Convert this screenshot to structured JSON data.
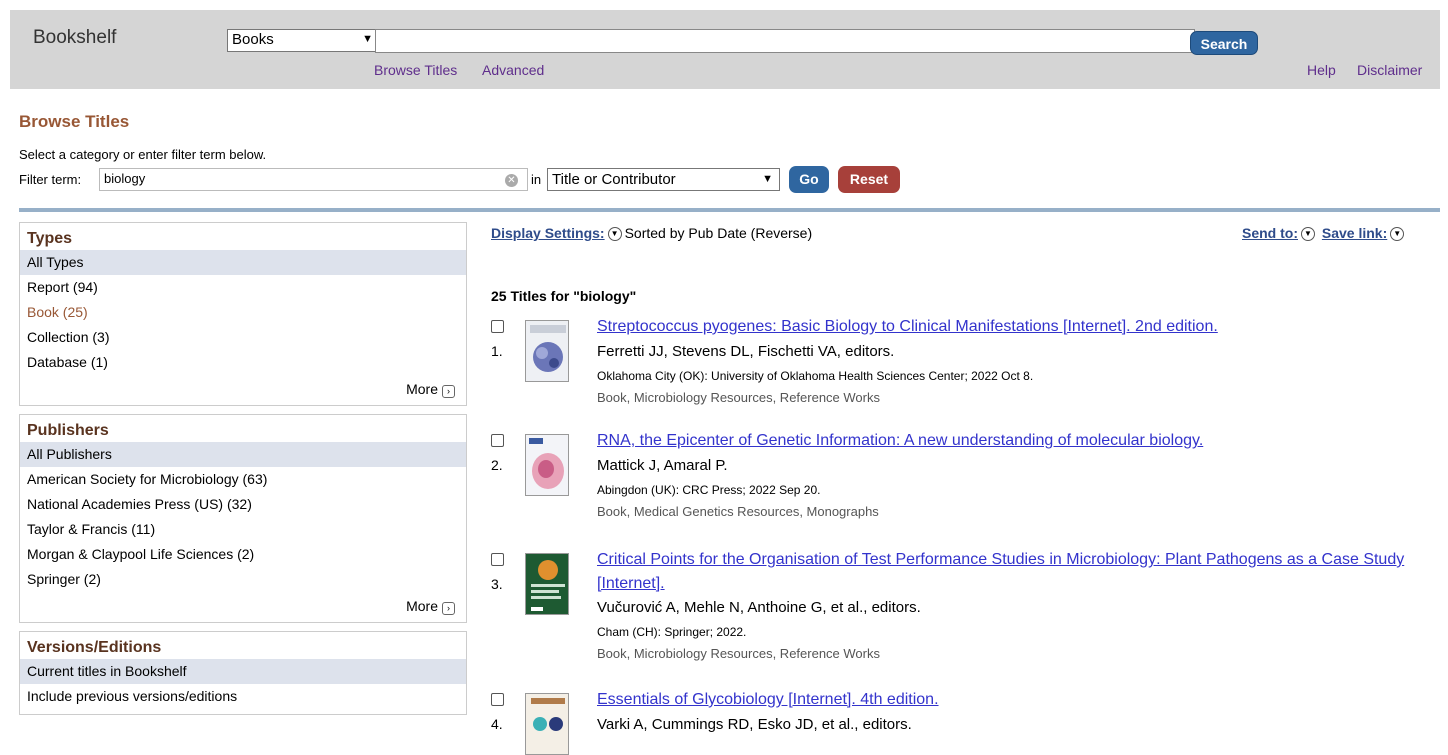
{
  "header": {
    "title": "Bookshelf",
    "db_select": "Books",
    "search_value": "",
    "search_button": "Search",
    "links": {
      "browse_titles": "Browse Titles",
      "advanced": "Advanced",
      "help": "Help",
      "disclaimer": "Disclaimer"
    }
  },
  "browse": {
    "title": "Browse Titles",
    "instructions": "Select a category or enter filter term below.",
    "filter_label": "Filter term:",
    "filter_value": "biology",
    "in_label": "in",
    "field_select": "Title or Contributor",
    "go_button": "Go",
    "reset_button": "Reset"
  },
  "facets": {
    "types": {
      "title": "Types",
      "items": [
        "All Types",
        "Report (94)",
        "Book (25)",
        "Collection (3)",
        "Database (1)"
      ],
      "more": "More"
    },
    "publishers": {
      "title": "Publishers",
      "items": [
        "All Publishers",
        "American Society for Microbiology (63)",
        "National Academies Press (US) (32)",
        "Taylor & Francis (11)",
        "Morgan & Claypool Life Sciences (2)",
        "Springer (2)"
      ],
      "more": "More"
    },
    "versions": {
      "title": "Versions/Editions",
      "items": [
        "Current titles in Bookshelf",
        "Include previous versions/editions"
      ]
    }
  },
  "results_bar": {
    "display_settings": "Display Settings:",
    "sort_text": "Sorted by Pub Date (Reverse)",
    "send_to": "Send to:",
    "save_link": "Save link:"
  },
  "results": {
    "count_heading": "25 Titles for \"biology\"",
    "items": [
      {
        "num": "1.",
        "title": "Streptococcus pyogenes: Basic Biology to Clinical Manifestations [Internet]. 2nd edition.",
        "authors": "Ferretti JJ, Stevens DL, Fischetti VA, editors.",
        "publisher": "Oklahoma City (OK): University of Oklahoma Health Sciences Center; 2022 Oct 8.",
        "tags": "Book, Microbiology Resources, Reference Works"
      },
      {
        "num": "2.",
        "title": "RNA, the Epicenter of Genetic Information: A new understanding of molecular biology.",
        "authors": "Mattick J, Amaral P.",
        "publisher": "Abingdon (UK): CRC Press; 2022 Sep 20.",
        "tags": "Book, Medical Genetics Resources, Monographs"
      },
      {
        "num": "3.",
        "title": "Critical Points for the Organisation of Test Performance Studies in Microbiology: Plant Pathogens as a Case Study [Internet].",
        "authors": "Vučurović A, Mehle N, Anthoine G, et al., editors.",
        "publisher": "Cham (CH): Springer; 2022.",
        "tags": "Book, Microbiology Resources, Reference Works"
      },
      {
        "num": "4.",
        "title": "Essentials of Glycobiology [Internet]. 4th edition.",
        "authors": "Varki A, Cummings RD, Esko JD, et al., editors.",
        "publisher": "",
        "tags": ""
      }
    ]
  },
  "colors": {
    "header_bg": "#d5d5d5",
    "title_brown": "#985735",
    "go_blue": "#2f66a0",
    "reset_red": "#a7403a",
    "link_blue": "#3333cc",
    "selected_bg": "#dde2ec"
  }
}
